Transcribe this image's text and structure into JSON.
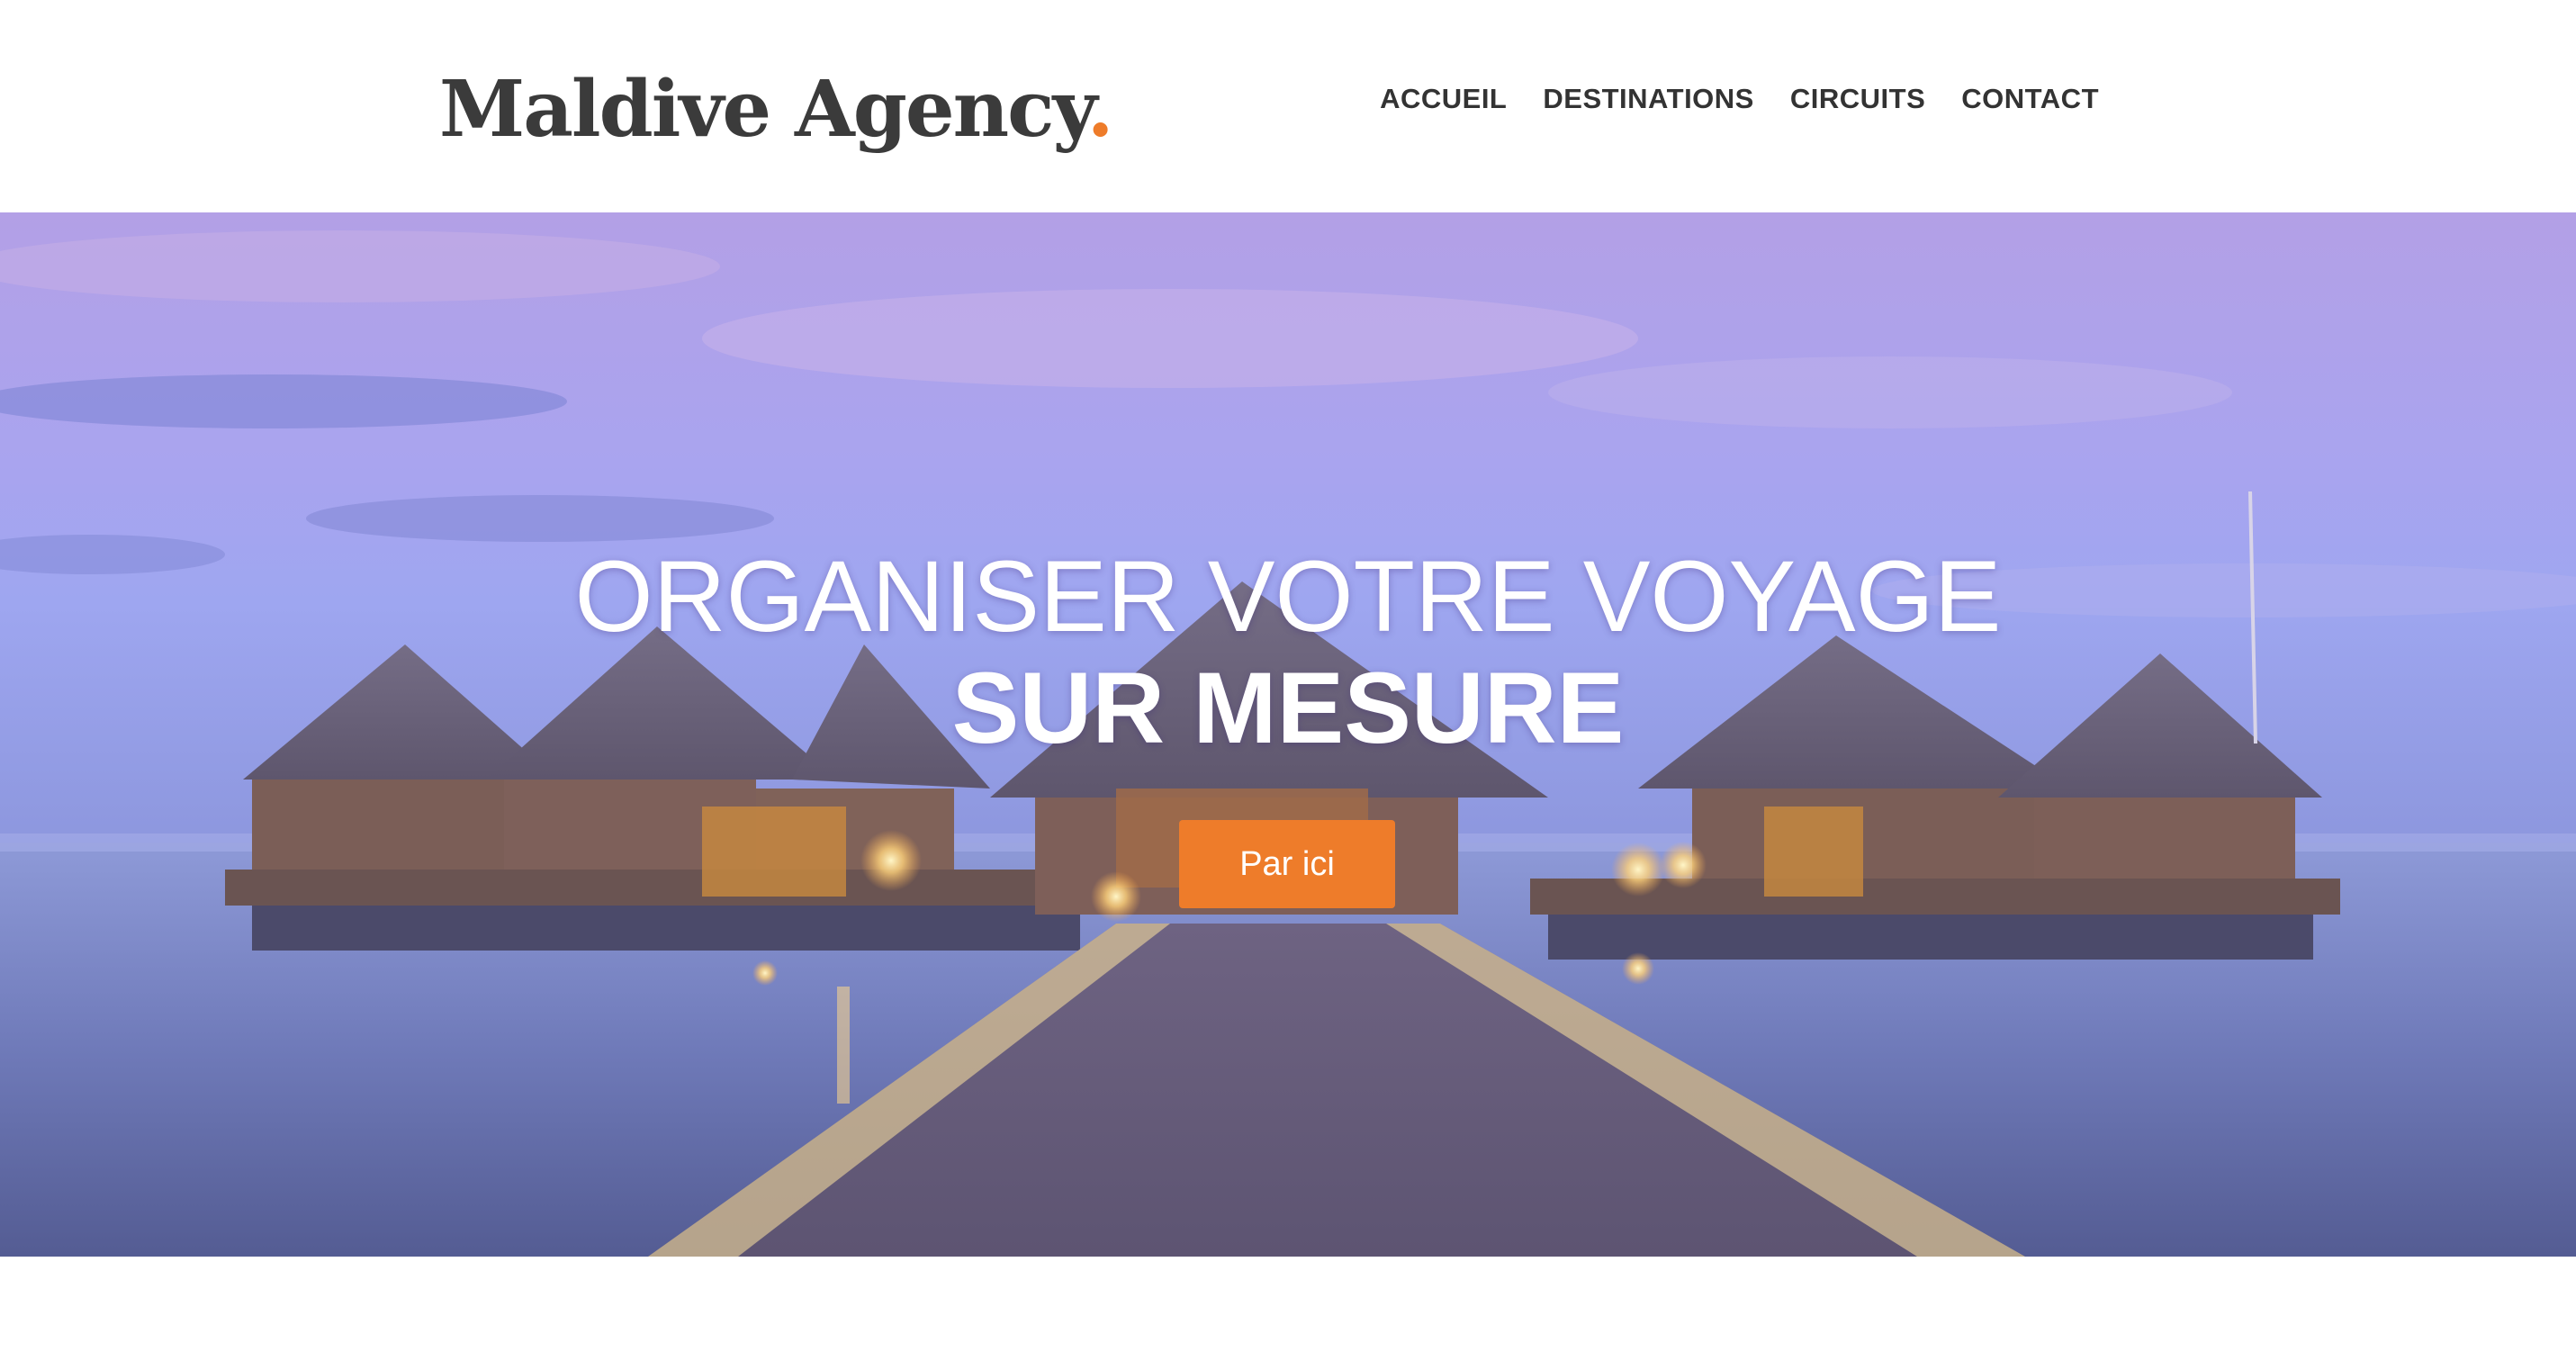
{
  "brand": {
    "name": "Maldive Agency",
    "dot": ".",
    "accent_color": "#ee7c2a"
  },
  "nav": {
    "items": [
      {
        "label": "ACCUEIL"
      },
      {
        "label": "DESTINATIONS"
      },
      {
        "label": "CIRCUITS"
      },
      {
        "label": "CONTACT"
      }
    ]
  },
  "hero": {
    "title_line1": "ORGANISER VOTRE VOYAGE",
    "title_line2": "SUR MESURE",
    "cta_label": "Par ici"
  }
}
